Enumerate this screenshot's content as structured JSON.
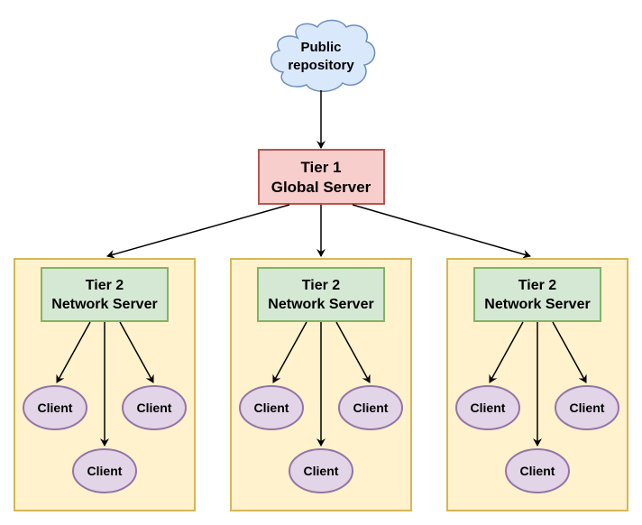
{
  "colors": {
    "cloud_fill": "#dae8fc",
    "cloud_stroke": "#6c8ebf",
    "tier1_fill": "#f8cecc",
    "tier1_stroke": "#b85450",
    "group_fill": "#fff2cc",
    "group_stroke": "#d6b656",
    "tier2_fill": "#d5e8d4",
    "tier2_stroke": "#82b366",
    "client_fill": "#e1d5e7",
    "client_stroke": "#9673a6",
    "edge": "#000000"
  },
  "repository": {
    "line1": "Public",
    "line2": "repository"
  },
  "tier1": {
    "line1": "Tier 1",
    "line2": "Global Server"
  },
  "groups": [
    {
      "server": {
        "line1": "Tier 2",
        "line2": "Network Server"
      },
      "clients": [
        "Client",
        "Client",
        "Client"
      ]
    },
    {
      "server": {
        "line1": "Tier 2",
        "line2": "Network Server"
      },
      "clients": [
        "Client",
        "Client",
        "Client"
      ]
    },
    {
      "server": {
        "line1": "Tier 2",
        "line2": "Network Server"
      },
      "clients": [
        "Client",
        "Client",
        "Client"
      ]
    }
  ]
}
